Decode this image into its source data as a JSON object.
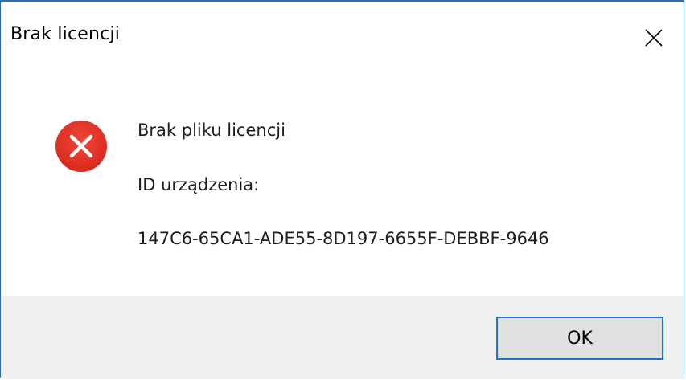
{
  "window": {
    "title": "Brak licencji"
  },
  "icons": {
    "close": "close-icon",
    "error": "error-icon"
  },
  "message": {
    "line1": "Brak pliku licencji",
    "line2": "ID urządzenia:",
    "line3": "147C6-65CA1-ADE55-8D197-6655F-DEBBF-9646"
  },
  "buttons": {
    "ok_label": "OK"
  },
  "colors": {
    "window_border": "#1f6fc1",
    "error_red": "#e81123",
    "footer_bg": "#f0f0f0",
    "button_border_focus": "#1a73d9",
    "button_bg": "#e1e1e1"
  }
}
